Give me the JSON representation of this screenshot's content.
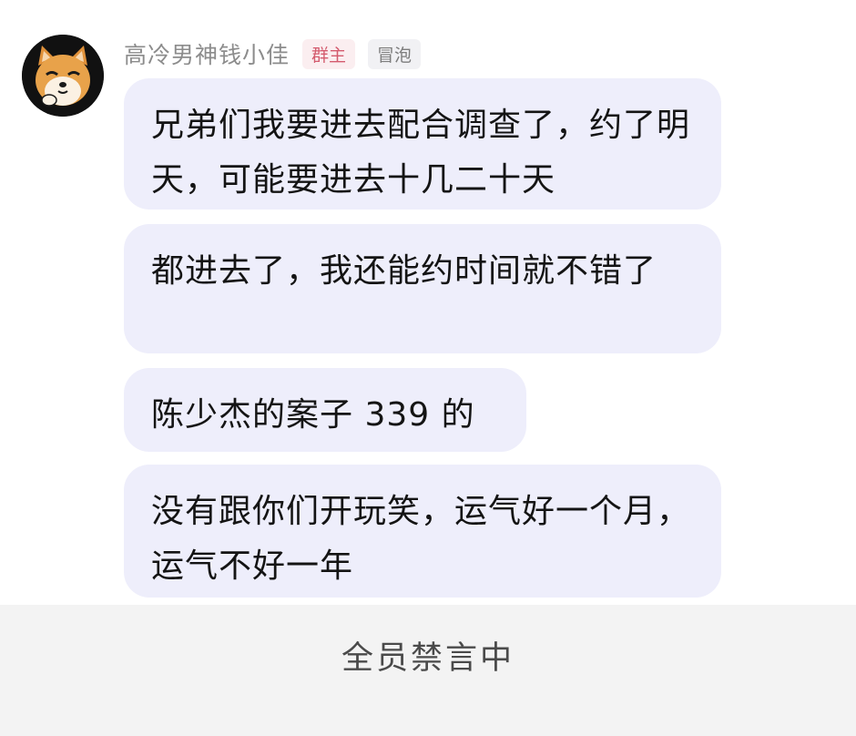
{
  "sender": {
    "name": "高冷男神钱小佳",
    "badges": {
      "owner": "群主",
      "bubble": "冒泡"
    },
    "avatar_icon": "shiba-dog-avatar-icon"
  },
  "messages": [
    {
      "text": "兄弟们我要进去配合调查了，约了明天，可能要进去十几二十天"
    },
    {
      "text": "都进去了，我还能约时间就不错了"
    },
    {
      "text": "陈少杰的案子 339 的"
    },
    {
      "text": "没有跟你们开玩笑，运气好一个月，运气不好一年"
    }
  ],
  "footer": {
    "status": "全员禁言中"
  },
  "colors": {
    "bubble_background": "#eeeefb",
    "owner_badge_text": "#d45b6e",
    "footer_background": "#f3f3f3"
  }
}
